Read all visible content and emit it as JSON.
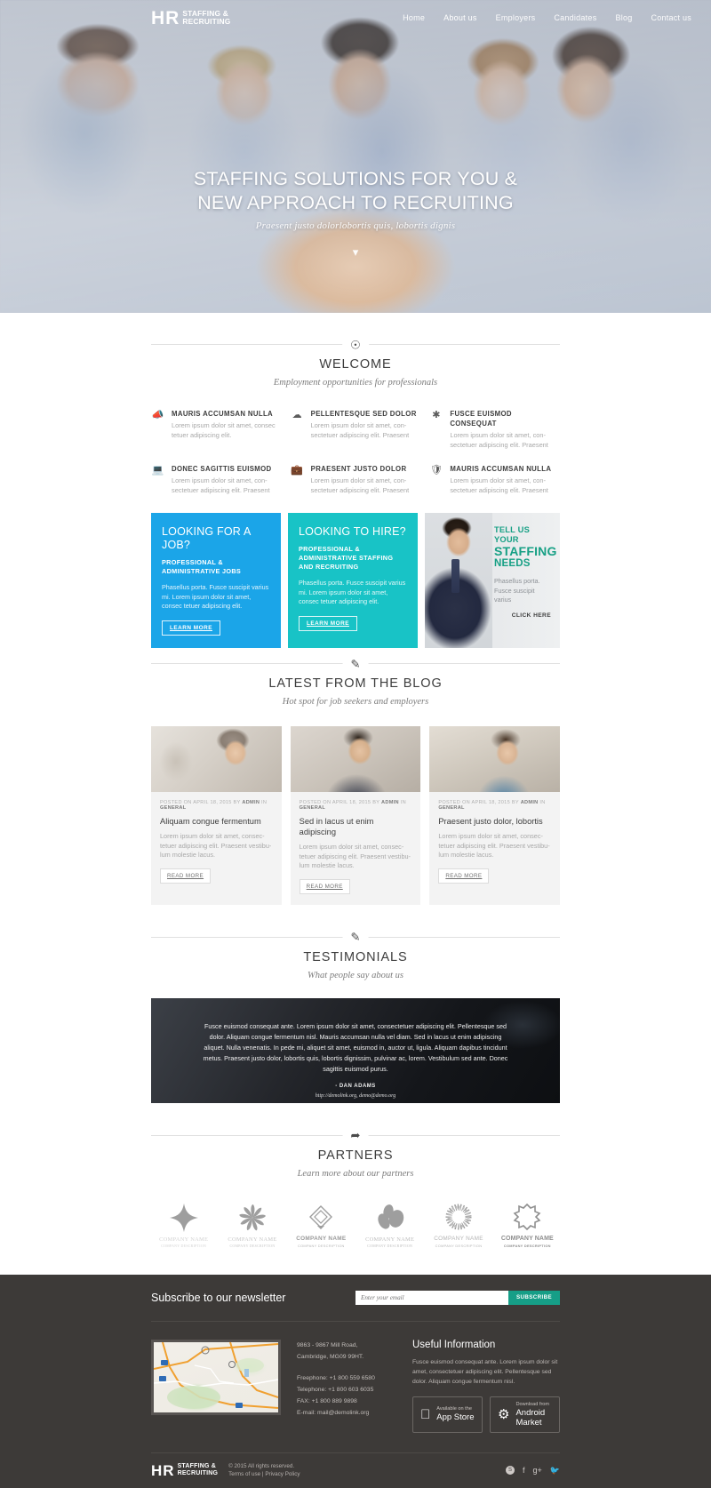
{
  "brand": {
    "abbr": "HR",
    "line1": "STAFFING &",
    "line2": "RECRUITING"
  },
  "nav": [
    {
      "label": "Home",
      "active": false
    },
    {
      "label": "About us",
      "active": true
    },
    {
      "label": "Employers",
      "active": false
    },
    {
      "label": "Candidates",
      "active": false
    },
    {
      "label": "Blog",
      "active": false
    },
    {
      "label": "Contact us",
      "active": false
    }
  ],
  "hero": {
    "title_line1": "STAFFING SOLUTIONS FOR YOU &",
    "title_line2": "NEW APPROACH TO RECRUITING",
    "tagline": "Praesent justo dolorlobortis quis, lobortis dignis",
    "scroll_icon": "chevron-down-icon"
  },
  "welcome": {
    "icon": "bell-icon",
    "title": "WELCOME",
    "subtitle": "Employment opportunities for professionals",
    "features": [
      {
        "icon": "megaphone-icon",
        "glyph": "📢",
        "title": "MAURIS ACCUMSAN NULLA",
        "text": "Lorem ipsum dolor sit amet, consec tetuer adipiscing elit."
      },
      {
        "icon": "cloud-icon",
        "glyph": "☁",
        "title": "PELLENTESQUE SED DOLOR",
        "text": "Lorem ipsum dolor sit amet, con-sectetuer adipiscing elit. Praesent"
      },
      {
        "icon": "asterisk-icon",
        "glyph": "✱",
        "title": "FUSCE EUISMOD CONSEQUAT",
        "text": "Lorem ipsum dolor sit amet, con-sectetuer adipiscing elit. Praesent"
      },
      {
        "icon": "laptop-icon",
        "glyph": "💻",
        "title": "DONEC SAGITTIS EUISMOD",
        "text": "Lorem ipsum dolor sit amet, con-sectetuer adipiscing elit. Praesent"
      },
      {
        "icon": "briefcase-icon",
        "glyph": "💼",
        "title": "PRAESENT JUSTO DOLOR",
        "text": "Lorem ipsum dolor sit amet, con-sectetuer adipiscing elit. Praesent"
      },
      {
        "icon": "shield-icon",
        "glyph": "🛡",
        "title": "MAURIS ACCUMSAN NULLA",
        "text": "Lorem ipsum dolor sit amet, con-sectetuer adipiscing elit. Praesent"
      }
    ]
  },
  "promos": [
    {
      "heading": "LOOKING FOR A JOB?",
      "sub": "PROFESSIONAL & ADMINISTRATIVE JOBS",
      "text": "Phasellus porta. Fusce suscipit varius mi. Lorem ipsum dolor sit amet, consec tetuer adipiscing elit.",
      "button": "LEARN MORE",
      "color": "#1ba5e8"
    },
    {
      "heading": "LOOKING TO HIRE?",
      "sub": "PROFESSIONAL & ADMINISTRATIVE STAFFING AND RECRUITING",
      "text": "Phasellus porta. Fusce suscipit varius mi. Lorem ipsum dolor sit amet, consec tetuer adipiscing elit.",
      "button": "LEARN MORE",
      "color": "#18c3c6"
    }
  ],
  "ad": {
    "line1": "TELL US YOUR",
    "line2": "STAFFING",
    "line3": "NEEDS",
    "text": "Phasellus porta. Fusce suscipit varius",
    "cta": "CLICK HERE",
    "accent": "#17a085"
  },
  "blog": {
    "icon": "pencil-icon",
    "title": "LATEST FROM THE BLOG",
    "subtitle": "Hot spot for job seekers and employers",
    "posts": [
      {
        "meta_prefix": "POSTED ON APRIL 18, 2015 BY ",
        "meta_author": "ADMIN",
        "meta_mid": " IN ",
        "meta_cat": "GENERAL",
        "title": "Aliquam congue fermentum",
        "text": "Lorem ipsum dolor sit amet, consec-tetuer adipiscing elit. Praesent vestibu-lum molestie lacus.",
        "button": "READ MORE"
      },
      {
        "meta_prefix": "POSTED ON APRIL 18, 2015 BY ",
        "meta_author": "ADMIN",
        "meta_mid": " IN ",
        "meta_cat": "GENERAL",
        "title": "Sed in lacus ut enim adipiscing",
        "text": "Lorem ipsum dolor sit amet, consec-tetuer adipiscing elit. Praesent vestibu-lum molestie lacus.",
        "button": "READ MORE"
      },
      {
        "meta_prefix": "POSTED ON APRIL 18, 2015 BY ",
        "meta_author": "ADMIN",
        "meta_mid": " IN ",
        "meta_cat": "GENERAL",
        "title": "Praesent justo dolor, lobortis",
        "text": "Lorem ipsum dolor sit amet, consec-tetuer adipiscing elit. Praesent vestibu-lum molestie lacus.",
        "button": "READ MORE"
      }
    ]
  },
  "testimonials": {
    "icon": "pencil-icon",
    "title": "TESTIMONIALS",
    "subtitle": "What people say about us",
    "quote": "Fusce euismod consequat ante. Lorem ipsum dolor sit amet, consectetuer adipiscing elit. Pellentesque sed dolor. Aliquam congue fermentum nisl. Mauris accumsan nulla vel diam. Sed in lacus ut enim adipiscing aliquet. Nulla venenatis. In pede mi, aliquet sit amet, euismod in, auctor ut, ligula. Aliquam dapibus tincidunt metus. Praesent justo dolor, lobortis quis, lobortis dignissim, pulvinar ac, lorem. Vestibulum sed ante. Donec sagittis euismod purus.",
    "author": "- DAN ADAMS",
    "link": "http://demolink.org, demo@demo.org"
  },
  "partners": {
    "icon": "paper-plane-icon",
    "title": "PARTNERS",
    "subtitle": "Learn more about our partners",
    "items": [
      {
        "name": "COMPANY NAME",
        "desc": "COMPANY DESCRIPTION",
        "mark": "diamond-star-mark"
      },
      {
        "name": "COMPANY NAME",
        "desc": "COMPANY DESCRIPTION",
        "mark": "pinwheel-mark"
      },
      {
        "name": "COMPANY NAME",
        "desc": "COMPANY DESCRIPTION",
        "mark": "diamond-outline-mark"
      },
      {
        "name": "COMPANY NAME",
        "desc": "COMPANY DESCRIPTION",
        "mark": "leaves-mark"
      },
      {
        "name": "COMPANY NAME",
        "desc": "COMPANY DESCRIPTION",
        "mark": "swirl-ring-mark"
      },
      {
        "name": "COMPANY NAME",
        "desc": "COMPANY DESCRIPTION",
        "mark": "gear-star-mark"
      }
    ]
  },
  "newsletter": {
    "title": "Subscribe to our newsletter",
    "placeholder": "Enter your email",
    "value": "",
    "button": "SUBSCRIBE",
    "button_color": "#169e87"
  },
  "footer": {
    "address_line1": "9863 - 9867 Mill Road,",
    "address_line2": "Cambridge, MG09 99HT.",
    "freephone": "Freephone: +1 800 559 6580",
    "telephone": "Telephone: +1 800 603 6035",
    "fax": "FAX: +1 800 889 9898",
    "email": "E-mail: mail@demolink.org",
    "useful_title": "Useful Information",
    "useful_text": "Fusce euismod consequat ante. Lorem ipsum dolor sit amet, consectetuer adipiscing elit. Pellentesque sed dolor. Aliquam congue fermentum nisl.",
    "stores": [
      {
        "icon": "apple-icon",
        "glyph": "",
        "line1": "Available on the",
        "line2": "App Store"
      },
      {
        "icon": "android-icon",
        "glyph": "⚙",
        "line1": "Download from",
        "line2": "Android Market"
      }
    ],
    "copyright": "© 2015 All rights reserved.",
    "terms": "Terms of use",
    "separator": " | ",
    "privacy": "Privacy Policy",
    "socials": [
      {
        "icon": "skype-icon",
        "glyph": "S"
      },
      {
        "icon": "facebook-icon",
        "glyph": "f"
      },
      {
        "icon": "google-plus-icon",
        "glyph": "g+"
      },
      {
        "icon": "twitter-icon",
        "glyph": "ᵥ"
      }
    ]
  }
}
